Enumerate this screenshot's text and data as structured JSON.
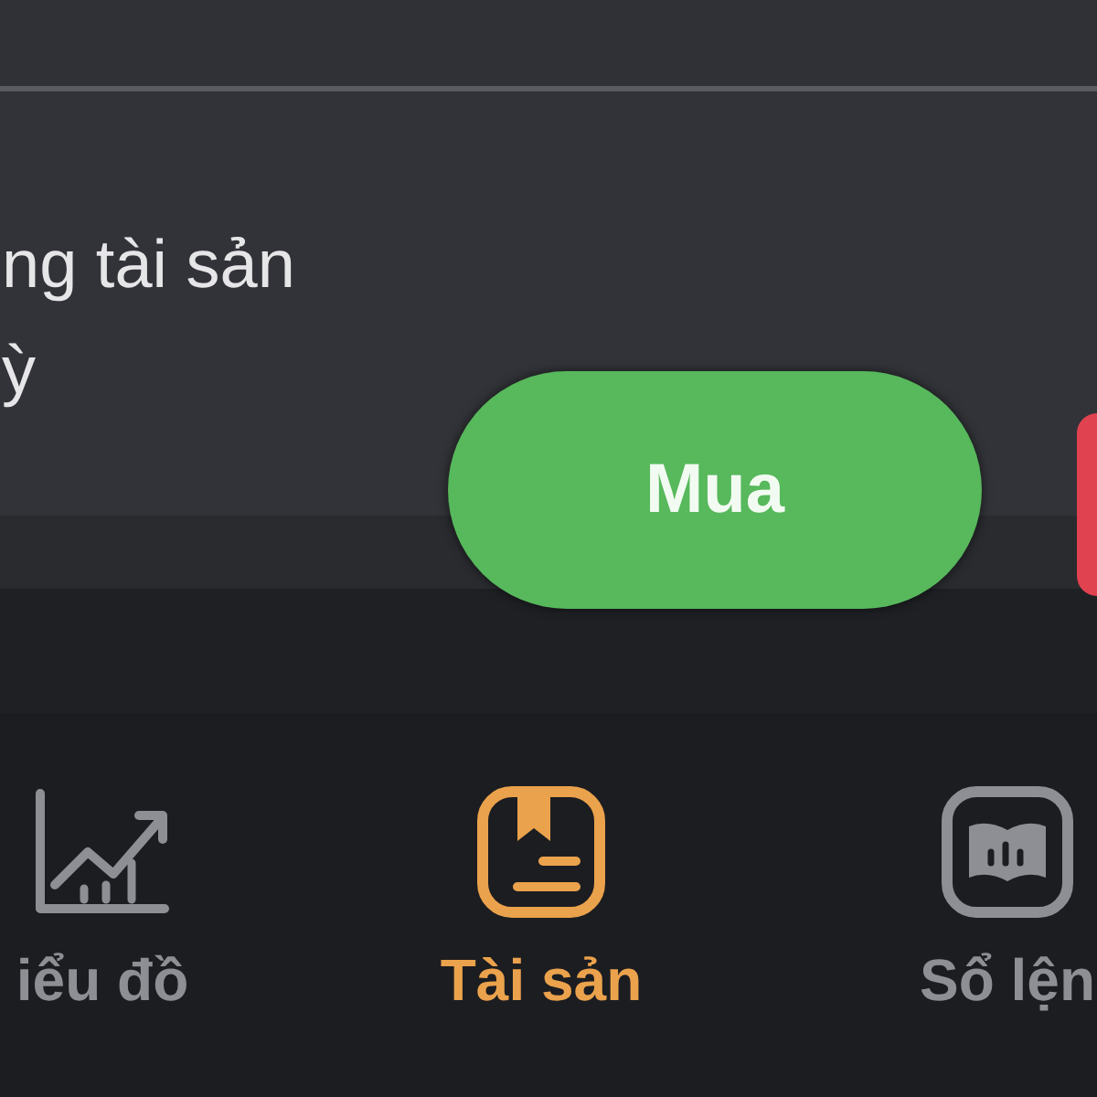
{
  "panel": {
    "text_lines": [
      "ng tài sản",
      "ỳ"
    ]
  },
  "buttons": [
    {
      "kind": "primary",
      "label": "Mua"
    },
    {
      "kind": "secondary"
    }
  ],
  "bottom_nav": [
    {
      "label": "iểu đồ",
      "kind": "chart",
      "selected": false
    },
    {
      "label": "Tài sản",
      "kind": "bookmark",
      "selected": true
    },
    {
      "label": "Sổ lện",
      "kind": "book",
      "selected": false
    }
  ]
}
